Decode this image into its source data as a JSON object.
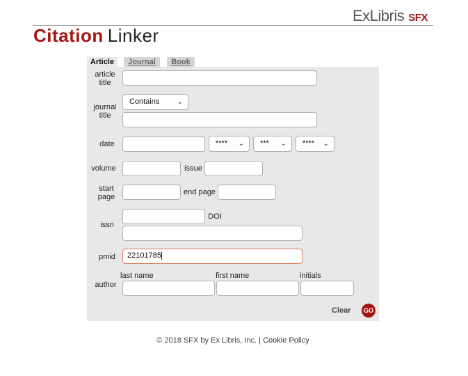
{
  "brand": {
    "name": "ExLibris",
    "product": "SFX"
  },
  "header": {
    "title_part1": "Citation",
    "title_part2": "Linker"
  },
  "tabs": [
    {
      "label": "Article",
      "active": true
    },
    {
      "label": "Journal",
      "active": false
    },
    {
      "label": "Book",
      "active": false
    }
  ],
  "form": {
    "article_title_label_1": "article",
    "article_title_label_2": "title",
    "journal_title_label_1": "journal",
    "journal_title_label_2": "title",
    "journal_match_select": "Contains",
    "date_label": "date",
    "date_year_select": "****",
    "date_month_select": "***",
    "date_day_select": "****",
    "volume_label": "volume",
    "issue_label": "issue",
    "start_page_label_1": "start",
    "start_page_label_2": "page",
    "end_page_label": "end page",
    "issn_label": "issn",
    "doi_label": "DOI",
    "pmid_label": "pmid",
    "pmid_value": "22101785",
    "author_label": "author",
    "last_name_label": "last name",
    "first_name_label": "first name",
    "initials_label": "initials",
    "clear_label": "Clear",
    "go_label": "GO"
  },
  "footer": {
    "copyright": "© 2018 SFX by Ex Libris, Inc. |",
    "cookie_link": "Cookie Policy"
  },
  "colors": {
    "accent": "#a31515",
    "panel": "#e8e8e8",
    "focus_border": "#e07a5f"
  }
}
